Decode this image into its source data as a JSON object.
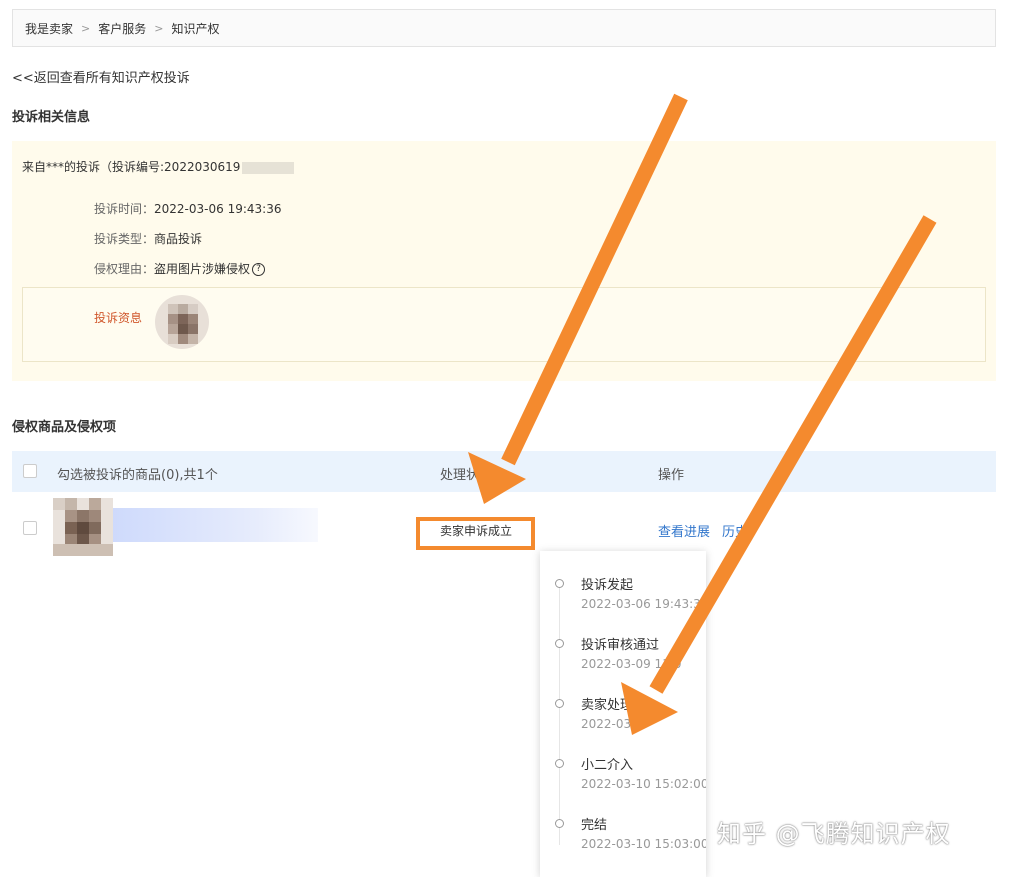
{
  "breadcrumb": {
    "items": [
      "我是卖家",
      "客户服务",
      "知识产权"
    ],
    "separator": ">"
  },
  "back_link": "<<返回查看所有知识产权投诉",
  "complaint_info": {
    "section_title": "投诉相关信息",
    "from_prefix": "来自***的投诉（投诉编号:2022030619",
    "time_label": "投诉时间：",
    "time_value": "2022-03-06 19:43:36",
    "type_label": "投诉类型：",
    "type_value": "商品投诉",
    "reason_label": "侵权理由：",
    "reason_value": "盗用图片涉嫌侵权",
    "help_glyph": "?",
    "evidence_label": "投诉资息"
  },
  "products": {
    "section_title": "侵权商品及侵权项",
    "header": {
      "select_label": "勾选被投诉的商品(0),共1个",
      "status": "处理状",
      "ops": "操作"
    },
    "rows": [
      {
        "status": "卖家申诉成立",
        "op_progress": "查看进展",
        "op_history": "历史"
      }
    ]
  },
  "progress_popover": {
    "steps": [
      {
        "title": "投诉发起",
        "time": "2022-03-06 19:43:36"
      },
      {
        "title": "投诉审核通过",
        "time": "2022-03-09 11:0"
      },
      {
        "title": "卖家处理",
        "time": "2022-03-"
      },
      {
        "title": "小二介入",
        "time": "2022-03-10 15:02:00"
      },
      {
        "title": "完结",
        "time": "2022-03-10 15:03:00"
      }
    ]
  },
  "watermark": "知乎 @飞腾知识产权",
  "colors": {
    "accent_link": "#3377cc",
    "annotation_orange": "#f48a2e",
    "panel_bg": "#fffbec",
    "table_head_bg": "#eaf3fd",
    "evidence_label": "#d0562b"
  }
}
